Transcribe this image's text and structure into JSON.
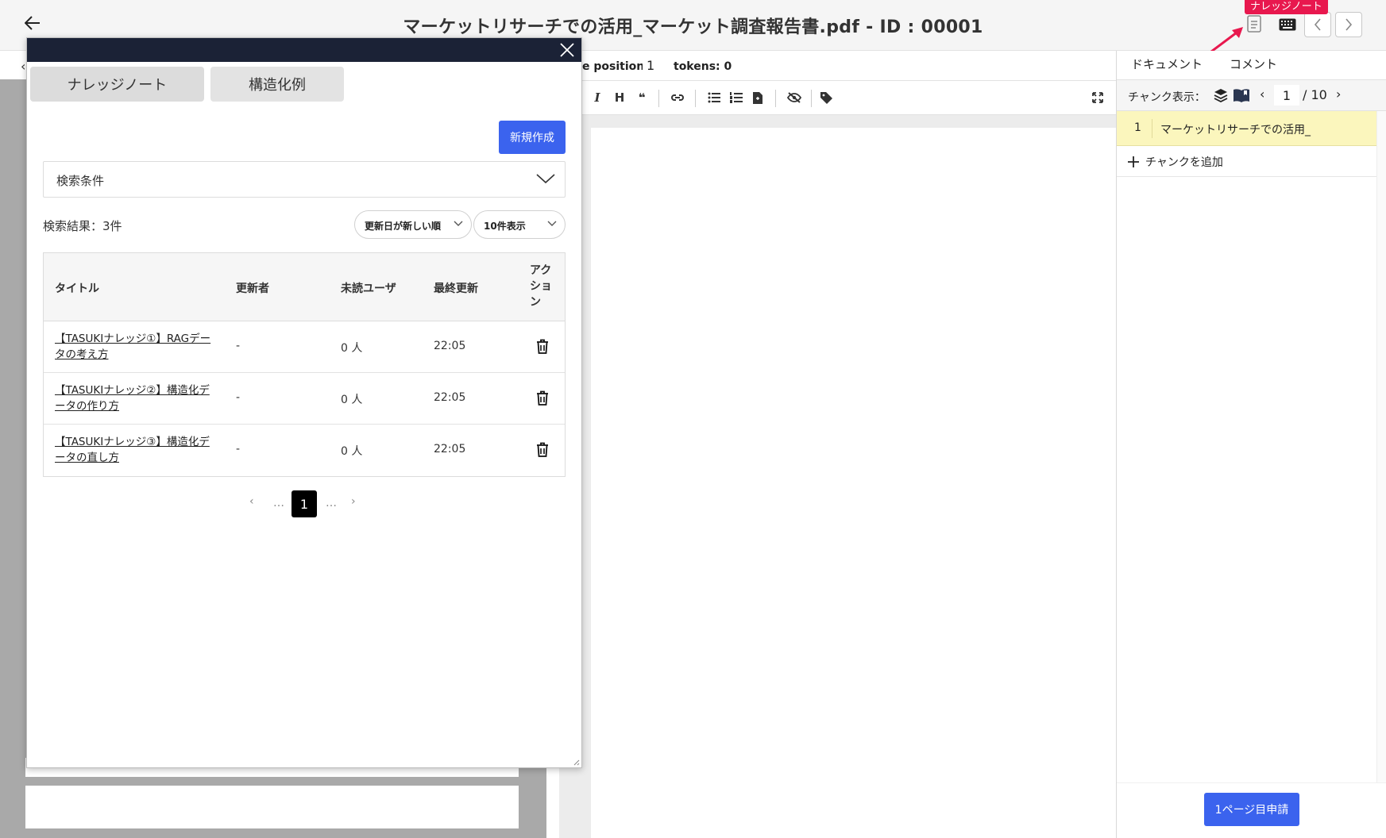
{
  "header": {
    "title": "マーケットリサーチでの活用_マーケット調査報告書.pdf - ID : 00001",
    "tooltip": "ナレッジノート"
  },
  "editor": {
    "position_label": "e position:",
    "position_value": "1",
    "tokens_label": "tokens: 0",
    "toolbar": {
      "italic": "I",
      "heading": "H",
      "quote": "❝"
    }
  },
  "sidebar": {
    "tabs": [
      "ドキュメント",
      "コメント"
    ],
    "chunk_label": "チャンク表示：",
    "chunk_page": "1",
    "chunk_total": "/ 10",
    "chunks": [
      {
        "num": "1",
        "text": "マーケットリサーチでの活用_"
      }
    ],
    "add_chunk": "チャンクを追加",
    "submit_label": "1ページ目申請"
  },
  "modal": {
    "tabs": [
      "ナレッジノート",
      "構造化例"
    ],
    "new_button": "新規作成",
    "search_conditions": "検索条件",
    "result_count": "検索結果：3件",
    "sort_value": "更新日が新しい順",
    "per_page_value": "10件表示",
    "columns": {
      "title": "タイトル",
      "updater": "更新者",
      "unread": "未読ユーザ",
      "last_updated": "最終更新",
      "action": "アクション"
    },
    "rows": [
      {
        "title": "【TASUKIナレッジ①】RAGデータの考え方",
        "updater": "-",
        "unread": "0 人",
        "last_updated": "22:05"
      },
      {
        "title": "【TASUKIナレッジ②】構造化データの作り方",
        "updater": "-",
        "unread": "0 人",
        "last_updated": "22:05"
      },
      {
        "title": "【TASUKIナレッジ③】構造化データの直し方",
        "updater": "-",
        "unread": "0 人",
        "last_updated": "22:05"
      }
    ],
    "pagination": {
      "prev": "‹",
      "dots": "…",
      "current": "1",
      "next": "›"
    }
  },
  "colors": {
    "primary": "#3b63ee",
    "modal_bar": "#1b2236",
    "tooltip": "#e8184e",
    "chunk_highlight": "#fbf6bd"
  }
}
